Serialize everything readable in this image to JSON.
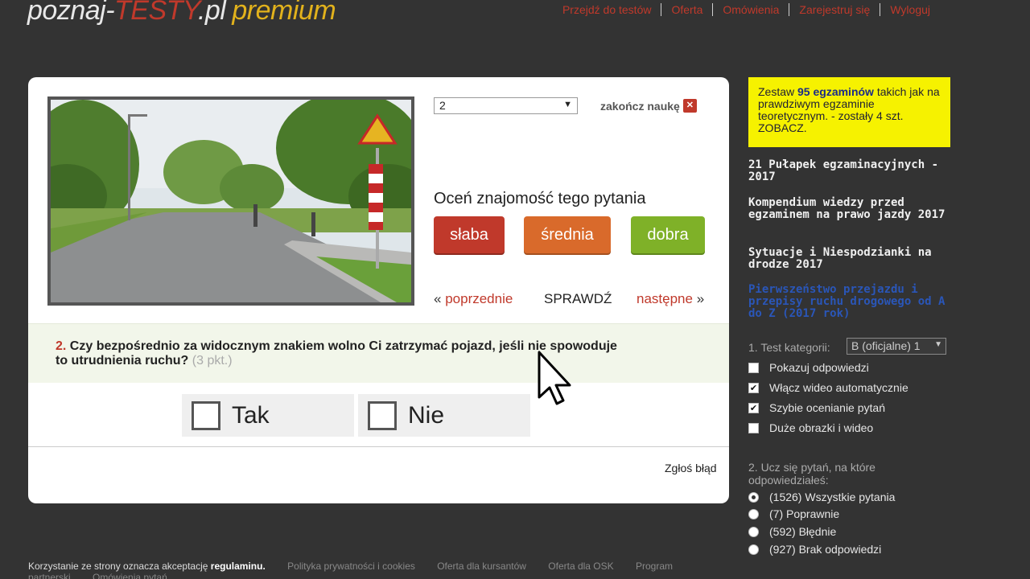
{
  "logo": {
    "part1": "poznaj-",
    "part2": "TESTY",
    "part3": ".pl",
    "part4": "premium"
  },
  "top_nav": [
    "Przejdź do testów",
    "Oferta",
    "Omówienia",
    "Zarejestruj się",
    "Wyloguj"
  ],
  "question_select": {
    "value": "2"
  },
  "end_learning": {
    "label": "zakończ naukę",
    "icon": "close-icon"
  },
  "rating": {
    "prompt": "Oceń znajomość tego pytania",
    "buttons": [
      {
        "label": "słaba",
        "color": "#c0392b"
      },
      {
        "label": "średnia",
        "color": "#d96a2b"
      },
      {
        "label": "dobra",
        "color": "#7fb128"
      }
    ]
  },
  "navigation": {
    "prev_arrow": "«",
    "prev": "poprzednie",
    "check": "SPRAWDŹ",
    "next": "następne",
    "next_arrow": "»"
  },
  "question": {
    "number": "2.",
    "text": "Czy bezpośrednio za widocznym znakiem wolno Ci zatrzymać pojazd, jeśli nie spowoduje to utrudnienia ruchu?",
    "points": "(3 pkt.)"
  },
  "answers": [
    {
      "label": "Tak",
      "checked": false
    },
    {
      "label": "Nie",
      "checked": false
    }
  ],
  "report_error": "Zgłoś błąd",
  "promo": {
    "text_before": "Zestaw ",
    "highlight": "95 egzaminów",
    "text_after": " takich jak na prawdziwym egzaminie teoretycznym. - zostały 4 szt. ZOBACZ."
  },
  "sidebar_links": [
    "21 Pułapek egzaminacyjnych - 2017",
    "Kompendium wiedzy przed egzaminem na prawo jazdy 2017",
    "Sytuacje i Niespodzianki na drodze 2017",
    "Pierwszeństwo przejazdu i przepisy ruchu drogowego od A do Z (2017 rok)"
  ],
  "settings": {
    "category_label": "1. Test kategorii:",
    "category_value": "B (oficjalne) 1",
    "options": [
      {
        "label": "Pokazuj odpowiedzi",
        "checked": false
      },
      {
        "label": "Włącz wideo automatycznie",
        "checked": true
      },
      {
        "label": "Szybie ocenianie pytań",
        "checked": true
      },
      {
        "label": "Duże obrazki i wideo",
        "checked": false
      }
    ]
  },
  "learn": {
    "label": "2. Ucz się pytań, na które odpowiedziałeś:",
    "options": [
      {
        "label": "(1526) Wszystkie pytania",
        "selected": true
      },
      {
        "label": "(7) Poprawnie",
        "selected": false
      },
      {
        "label": "(592) Błędnie",
        "selected": false
      },
      {
        "label": "(927) Brak odpowiedzi",
        "selected": false
      }
    ]
  },
  "footer": {
    "notice_before": "Korzystanie ze strony oznacza akceptację ",
    "notice_link": "regulaminu.",
    "links": [
      "Polityka prywatności i cookies",
      "Oferta dla kursantów",
      "Oferta dla OSK",
      "Program partnerski",
      "Omówienia pytań"
    ]
  }
}
